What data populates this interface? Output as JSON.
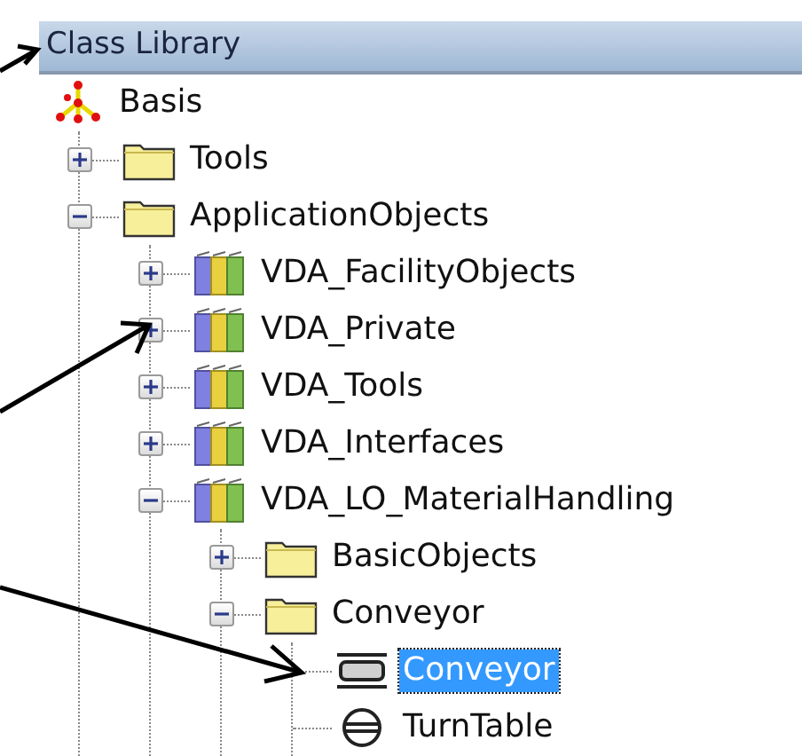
{
  "panel": {
    "title": "Class Library"
  },
  "tree": [
    {
      "label": "Basis",
      "kind": "root",
      "selected": false,
      "children": [
        {
          "label": "Tools",
          "kind": "folder",
          "expanded": false,
          "selected": false
        },
        {
          "label": "ApplicationObjects",
          "kind": "folder",
          "expanded": true,
          "selected": false,
          "children": [
            {
              "label": "VDA_FacilityObjects",
              "kind": "library",
              "expanded": false,
              "selected": false
            },
            {
              "label": "VDA_Private",
              "kind": "library",
              "expanded": false,
              "selected": false
            },
            {
              "label": "VDA_Tools",
              "kind": "library",
              "expanded": false,
              "selected": false
            },
            {
              "label": "VDA_Interfaces",
              "kind": "library",
              "expanded": false,
              "selected": false
            },
            {
              "label": "VDA_LO_MaterialHandling",
              "kind": "library",
              "expanded": true,
              "selected": false,
              "children": [
                {
                  "label": "BasicObjects",
                  "kind": "folder",
                  "expanded": false,
                  "selected": false
                },
                {
                  "label": "Conveyor",
                  "kind": "folder",
                  "expanded": true,
                  "selected": false,
                  "children": [
                    {
                      "label": "Conveyor",
                      "kind": "conveyor",
                      "selected": true
                    },
                    {
                      "label": "TurnTable",
                      "kind": "turntable",
                      "selected": false
                    }
                  ]
                }
              ]
            }
          ]
        }
      ]
    }
  ]
}
